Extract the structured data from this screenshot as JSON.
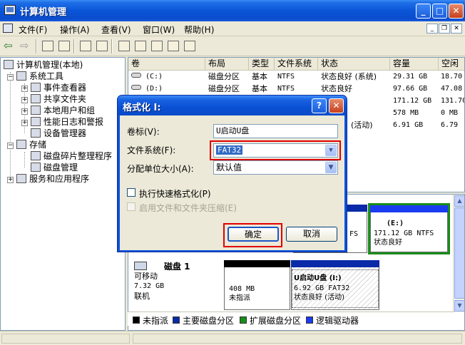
{
  "window": {
    "title": "计算机管理"
  },
  "menubar": {
    "items": [
      "文件(F)",
      "操作(A)",
      "查看(V)",
      "窗口(W)",
      "帮助(H)"
    ]
  },
  "tree": {
    "root": "计算机管理(本地)",
    "system_tools": "系统工具",
    "event_viewer": "事件查看器",
    "shared_folders": "共享文件夹",
    "local_users": "本地用户和组",
    "perf_logs": "性能日志和警报",
    "device_manager": "设备管理器",
    "storage": "存储",
    "defrag": "磁盘碎片整理程序",
    "disk_mgmt": "磁盘管理",
    "services": "服务和应用程序"
  },
  "volume_list": {
    "headers": [
      "卷",
      "布局",
      "类型",
      "文件系统",
      "状态",
      "容量",
      "空闲"
    ],
    "rows": [
      {
        "vol": "(C:)",
        "layout": "磁盘分区",
        "type": "基本",
        "fs": "NTFS",
        "status": "状态良好 (系统)",
        "capacity": "29.31 GB",
        "free": "18.70"
      },
      {
        "vol": "(D:)",
        "layout": "磁盘分区",
        "type": "基本",
        "fs": "NTFS",
        "status": "状态良好",
        "capacity": "97.66 GB",
        "free": "47.08"
      },
      {
        "vol": "",
        "layout": "",
        "type": "",
        "fs": "",
        "status": "",
        "capacity": "171.12 GB",
        "free": "131.70"
      },
      {
        "vol": "",
        "layout": "",
        "type": "",
        "fs": "",
        "status": "",
        "capacity": "578 MB",
        "free": "0 MB"
      },
      {
        "vol": "",
        "layout": "",
        "type": "",
        "fs": "",
        "status": "(活动)",
        "capacity": "6.91 GB",
        "free": "6.79"
      }
    ]
  },
  "graph": {
    "top_partition_fs_suffix": "FS",
    "e_partition": {
      "name": "(E:)",
      "size": "171.12 GB NTFS",
      "status": "状态良好"
    },
    "disk1": {
      "name": "磁盘 1",
      "type": "可移动",
      "size": "7.32 GB",
      "state": "联机"
    },
    "unalloc": {
      "size": "408 MB",
      "label": "未指派"
    },
    "usb": {
      "name": "U启动U盘  (I:)",
      "size": "6.92 GB FAT32",
      "status": "状态良好 (活动)"
    }
  },
  "legend": {
    "items": [
      {
        "label": "未指派",
        "color": "#000000"
      },
      {
        "label": "主要磁盘分区",
        "color": "#0a2aa8"
      },
      {
        "label": "扩展磁盘分区",
        "color": "#1a8c1a"
      },
      {
        "label": "逻辑驱动器",
        "color": "#1a3cf0"
      }
    ]
  },
  "dialog": {
    "title": "格式化 I:",
    "volume_label_label": "卷标(V):",
    "volume_label_value": "U启动U盘",
    "fs_label": "文件系统(F):",
    "fs_value": "FAT32",
    "alloc_label": "分配单位大小(A):",
    "alloc_value": "默认值",
    "quick_format": "执行快速格式化(P)",
    "compress": "启用文件和文件夹压缩(E)",
    "ok": "确定",
    "cancel": "取消"
  }
}
